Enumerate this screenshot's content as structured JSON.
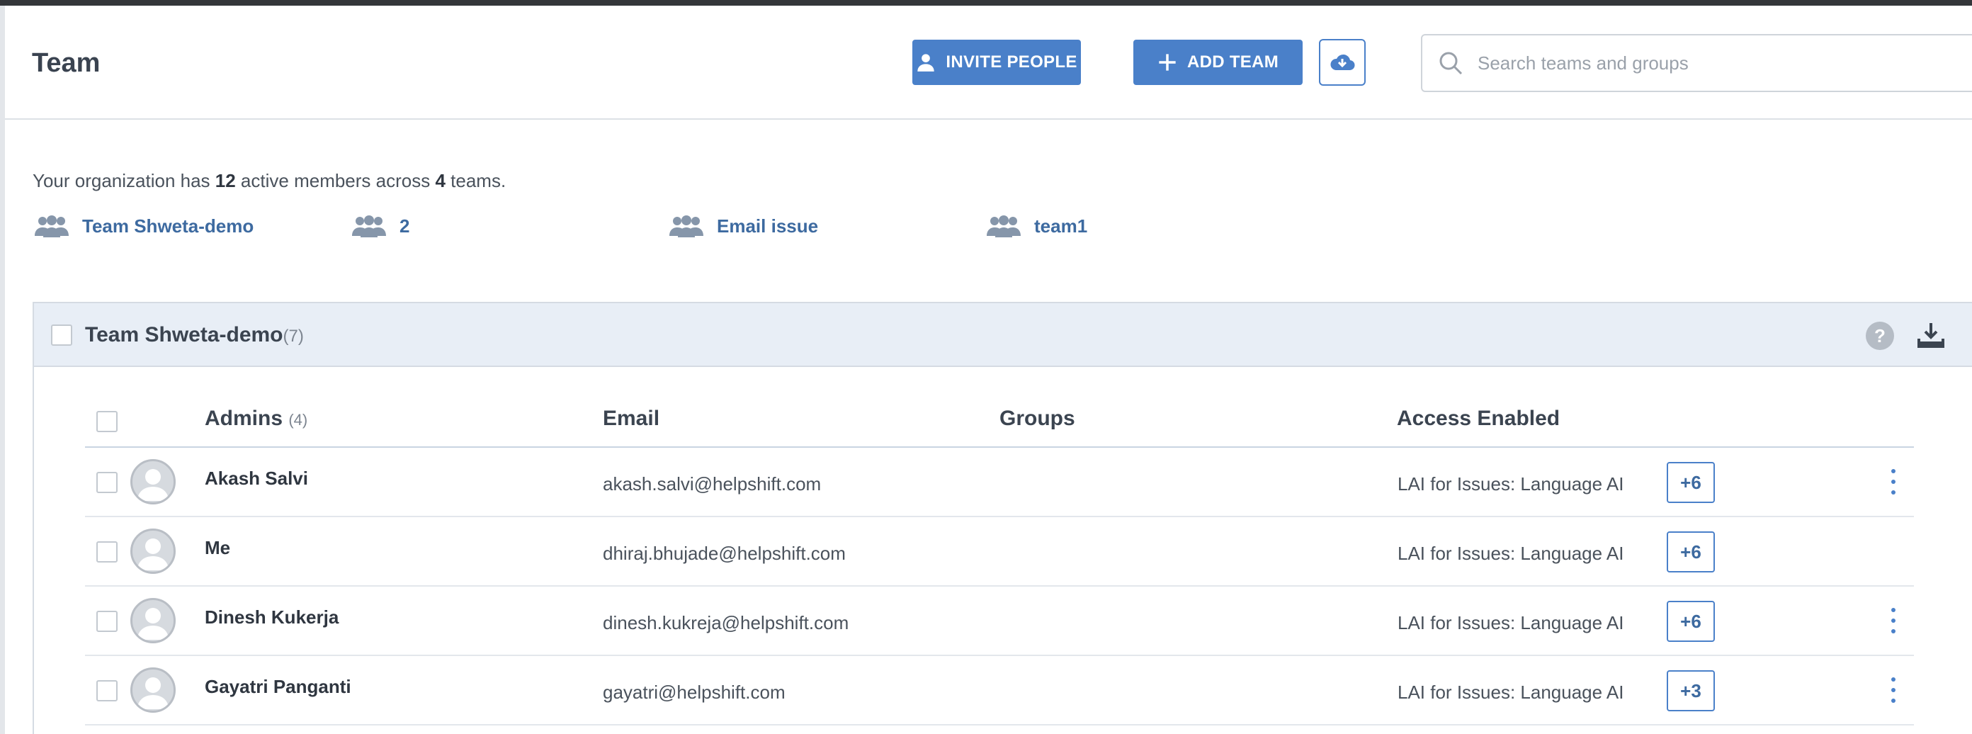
{
  "header": {
    "title": "Team",
    "invite_label": "INVITE PEOPLE",
    "add_team_label": "ADD TEAM",
    "search_placeholder": "Search teams and groups"
  },
  "summary": {
    "prefix": "Your organization has ",
    "members": "12",
    "middle": " active members across ",
    "teams": "4",
    "suffix": " teams."
  },
  "teams": [
    "Team Shweta-demo",
    "2",
    "Email issue",
    "team1"
  ],
  "panel": {
    "title": "Team Shweta-demo",
    "count": "(7)",
    "help": "?"
  },
  "table": {
    "columns": {
      "admins": "Admins",
      "admins_count": "(4)",
      "email": "Email",
      "groups": "Groups",
      "access": "Access Enabled"
    },
    "rows": [
      {
        "name": "Akash Salvi",
        "email": "akash.salvi@helpshift.com",
        "groups": "",
        "access": "LAI for Issues: Language AI",
        "more": "+6",
        "has_menu": true
      },
      {
        "name": "Me",
        "email": "dhiraj.bhujade@helpshift.com",
        "groups": "",
        "access": "LAI for Issues: Language AI",
        "more": "+6",
        "has_menu": false
      },
      {
        "name": "Dinesh Kukerja",
        "email": "dinesh.kukreja@helpshift.com",
        "groups": "",
        "access": "LAI for Issues: Language AI",
        "more": "+6",
        "has_menu": true
      },
      {
        "name": "Gayatri Panganti",
        "email": "gayatri@helpshift.com",
        "groups": "",
        "access": "LAI for Issues: Language AI",
        "more": "+3",
        "has_menu": true
      }
    ]
  },
  "colors": {
    "accent": "#4a80c9",
    "link": "#3d6aa0",
    "panel_header": "#e8eef6"
  }
}
